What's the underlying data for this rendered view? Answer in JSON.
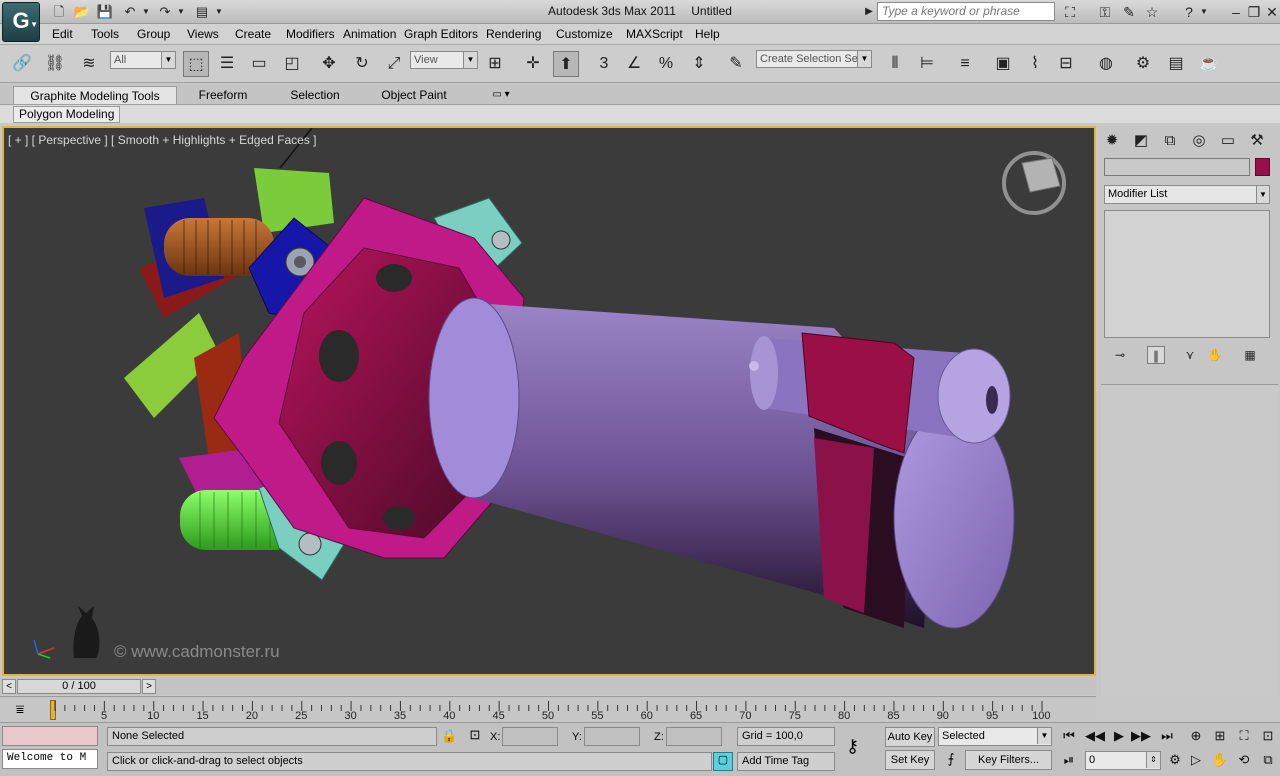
{
  "titlebar": {
    "app_name": "Autodesk 3ds Max  2011",
    "doc_name": "Untitled",
    "search_placeholder": "Type a keyword or phrase"
  },
  "menu": [
    "Edit",
    "Tools",
    "Group",
    "Views",
    "Create",
    "Modifiers",
    "Animation",
    "Graph Editors",
    "Rendering",
    "Customize",
    "MAXScript",
    "Help"
  ],
  "toolbar": {
    "selection_filter": "All",
    "ref_coord": "View",
    "named_selection": "Create Selection Se",
    "snap_number": "3"
  },
  "ribbon": {
    "tabs": [
      "Graphite Modeling Tools",
      "Freeform",
      "Selection",
      "Object Paint"
    ],
    "panel": "Polygon Modeling"
  },
  "viewport": {
    "label": "[ + ] [ Perspective ] [ Smooth + Highlights + Edged Faces ]",
    "watermark": "© www.cadmonster.ru"
  },
  "command_panel": {
    "modifier_list": "Modifier List",
    "object_color": "#9a0f4a"
  },
  "timeslider": {
    "position": "0 / 100",
    "ticks": [
      "5",
      "10",
      "15",
      "20",
      "25",
      "30",
      "35",
      "40",
      "45",
      "50",
      "55",
      "60",
      "65",
      "70",
      "75",
      "80",
      "85",
      "90",
      "95",
      "100"
    ]
  },
  "status": {
    "maxscript_listener": "Welcome to M",
    "selection_status": "None Selected",
    "prompt": "Click or click-and-drag to select objects",
    "x_label": "X:",
    "y_label": "Y:",
    "z_label": "Z:",
    "grid": "Grid = 100,0",
    "add_time_tag": "Add Time Tag",
    "auto_key": "Auto Key",
    "set_key": "Set Key",
    "key_mode": "Selected",
    "key_filters": "Key Filters...",
    "frame": "0"
  }
}
